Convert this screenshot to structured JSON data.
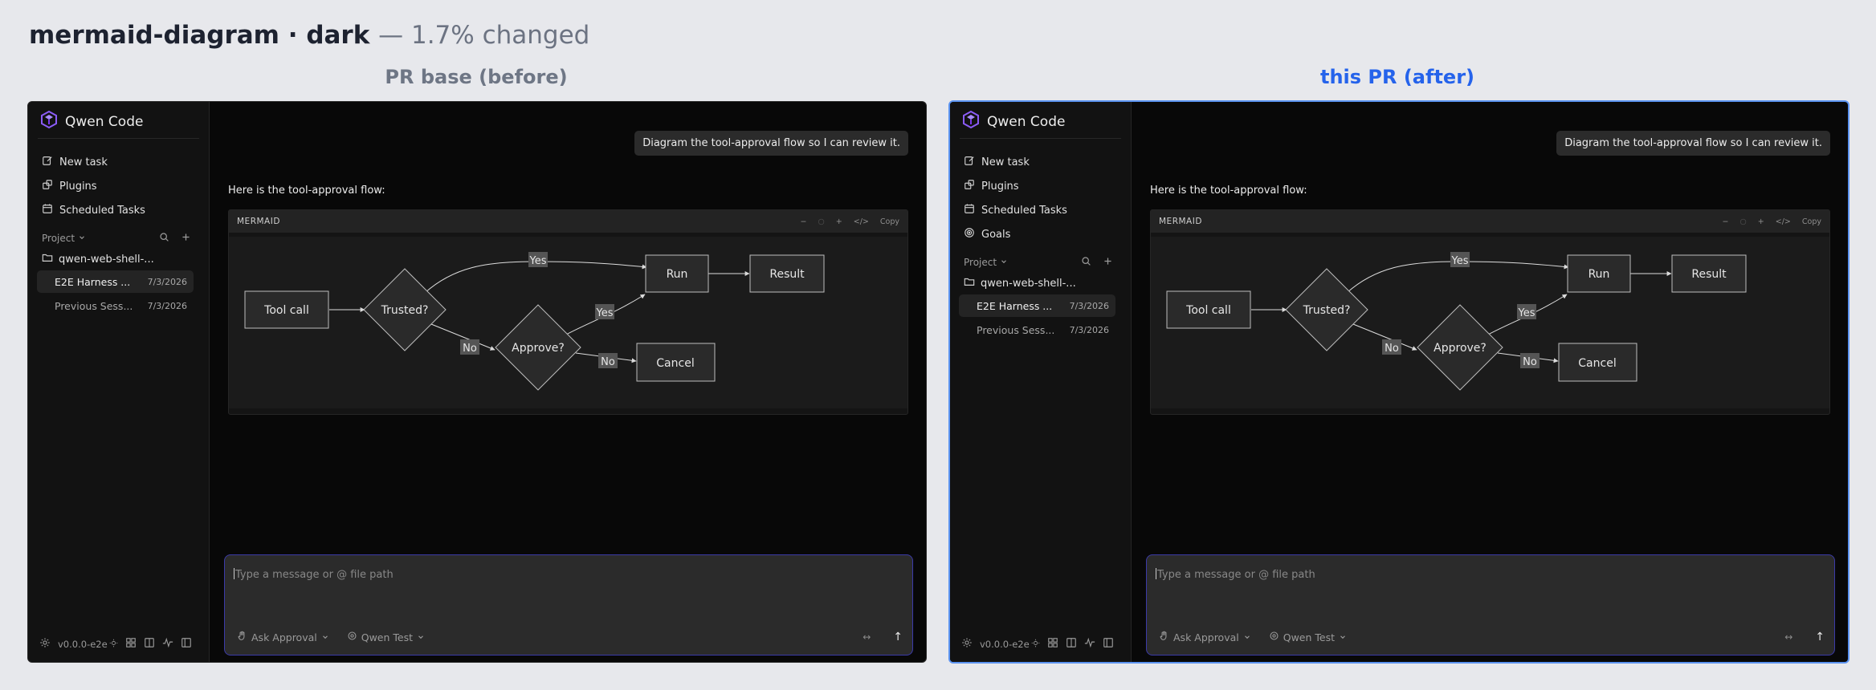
{
  "header": {
    "title": "mermaid-diagram · dark",
    "subtitle": "— 1.7% changed"
  },
  "columns": {
    "before": "PR base (before)",
    "after": "this PR (after)"
  },
  "app": {
    "name": "Qwen Code",
    "nav_before": [
      {
        "label": "New task",
        "icon": "edit-icon"
      },
      {
        "label": "Plugins",
        "icon": "plugin-icon"
      },
      {
        "label": "Scheduled Tasks",
        "icon": "calendar-icon"
      }
    ],
    "nav_after": [
      {
        "label": "New task",
        "icon": "edit-icon"
      },
      {
        "label": "Plugins",
        "icon": "plugin-icon"
      },
      {
        "label": "Scheduled Tasks",
        "icon": "calendar-icon"
      },
      {
        "label": "Goals",
        "icon": "target-icon"
      }
    ],
    "project_label": "Project",
    "folder": "qwen-web-shell-...",
    "sessions": [
      {
        "title": "E2E Harness ...",
        "date": "7/3/2026"
      },
      {
        "title": "Previous Sess...",
        "date": "7/3/2026"
      }
    ],
    "version": "v0.0.0-e2e",
    "user_message": "Diagram the tool-approval flow so I can review it.",
    "assistant_text": "Here is the tool-approval flow:",
    "mermaid": {
      "label": "MERMAID",
      "tools": [
        "−",
        "○",
        "+",
        "</>",
        "Copy"
      ],
      "nodes": {
        "toolcall": "Tool call",
        "trusted": "Trusted?",
        "approve": "Approve?",
        "run": "Run",
        "result": "Result",
        "cancel": "Cancel"
      },
      "edges": {
        "yes": "Yes",
        "no": "No"
      }
    },
    "composer": {
      "placeholder": "Type a message or @ file path",
      "mode": "Ask Approval",
      "model": "Qwen Test",
      "expand": "↔",
      "send": "↑"
    }
  }
}
